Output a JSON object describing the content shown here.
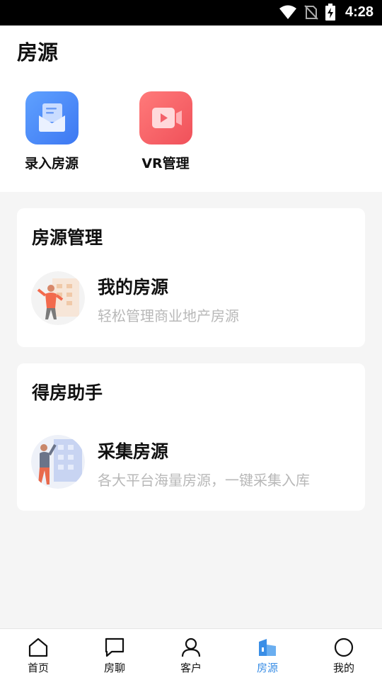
{
  "status_bar": {
    "time": "4:28"
  },
  "header": {
    "title": "房源"
  },
  "quick_actions": [
    {
      "label": "录入房源",
      "icon": "mail-icon",
      "color": "#4a8af4"
    },
    {
      "label": "VR管理",
      "icon": "video-icon",
      "color": "#f4606a"
    }
  ],
  "sections": [
    {
      "title": "房源管理",
      "item": {
        "title": "我的房源",
        "subtitle": "轻松管理商业地产房源",
        "icon": "person-building-icon"
      }
    },
    {
      "title": "得房助手",
      "item": {
        "title": "采集房源",
        "subtitle": "各大平台海量房源，一键采集入库",
        "icon": "person-building-icon"
      }
    }
  ],
  "tabbar": {
    "active": "房源",
    "accent": "#3a8ee6",
    "items": [
      {
        "label": "首页",
        "icon": "home-icon"
      },
      {
        "label": "房聊",
        "icon": "chat-icon"
      },
      {
        "label": "客户",
        "icon": "user-icon"
      },
      {
        "label": "房源",
        "icon": "building-icon"
      },
      {
        "label": "我的",
        "icon": "circle-icon"
      }
    ]
  }
}
